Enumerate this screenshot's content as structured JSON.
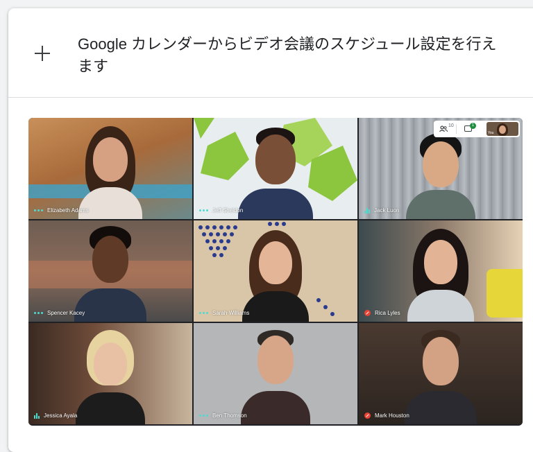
{
  "header": {
    "text": "Google カレンダーからビデオ会議のスケジュール設定を行えます"
  },
  "toolbar": {
    "participants_count": "10",
    "chat_badge": "1",
    "self_label": "You"
  },
  "participants": [
    {
      "name": "Elizabeth Adams",
      "audio": "dots"
    },
    {
      "name": "Jeff Sheldon",
      "audio": "dots"
    },
    {
      "name": "Jack Luon",
      "audio": "bars"
    },
    {
      "name": "Spencer Kacey",
      "audio": "dots"
    },
    {
      "name": "Sarah Williams",
      "audio": "dots"
    },
    {
      "name": "Rica Lyles",
      "audio": "muted"
    },
    {
      "name": "Jessica Ayala",
      "audio": "bars"
    },
    {
      "name": "Ben Thomson",
      "audio": "dots"
    },
    {
      "name": "Mark Houston",
      "audio": "muted"
    }
  ],
  "colors": {
    "accent": "#4ddbd0",
    "muted": "#ea4335",
    "chat_badge": "#1e8e3e"
  }
}
